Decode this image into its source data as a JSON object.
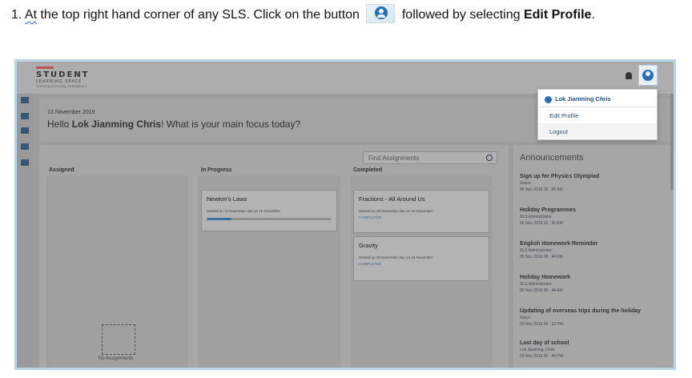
{
  "instruction": {
    "number": "1.",
    "at_text": "At",
    "text_before_icon": "the top right hand corner of any SLS. Click on the button",
    "text_after_icon": "followed by selecting",
    "bold_target": "Edit Profile",
    "end_punct": "."
  },
  "app": {
    "logo_line1": "STUDENT",
    "logo_line2": "LEARNING SPACE",
    "logo_line3": "Learning everyday, everywhere"
  },
  "greeting": {
    "date": "13 November 2019",
    "hello_prefix": "Hello",
    "user_name": "Lok Jianming Chris",
    "hello_suffix": "! What is your main focus today?"
  },
  "user_menu": {
    "user_name": "Lok Jianming Chris",
    "edit_profile": "Edit Profile",
    "logout": "Logout"
  },
  "board": {
    "search_placeholder": "Find Assignments",
    "columns": {
      "assigned": "Assigned",
      "in_progress": "In Progress",
      "completed": "Completed"
    },
    "empty_text": "No Assignments",
    "in_progress_cards": [
      {
        "title": "Newton's Laws",
        "sub": "Started on 10 November due on 11 November",
        "progress_percent": 20
      }
    ],
    "completed_cards": [
      {
        "title": "Fractions - All Around Us",
        "sub": "Started on 28 November due on 18 November",
        "status": "COMPLETED"
      },
      {
        "title": "Gravity",
        "sub": "Started on 05 November due on 18 November",
        "status": "COMPLETED"
      }
    ]
  },
  "announcements": {
    "title": "Announcements",
    "items": [
      {
        "title": "Sign up for Physics Olympiad",
        "author": "Grace",
        "date": "05 Nov 2019 10 : 56 AM"
      },
      {
        "title": "Holiday Programmes",
        "author": "SLS Administrator",
        "date": "05 Nov 2019 10 : 30 AM"
      },
      {
        "title": "English Homework Reminder",
        "author": "SLS Administrator",
        "date": "05 Nov 2019 09 : 44 AM"
      },
      {
        "title": "Holiday Homework",
        "author": "SLS Administrator",
        "date": "05 Nov 2019 09 : 44 AM"
      },
      {
        "title": "Updating of overseas trips during the holiday",
        "author": "Grace",
        "date": "03 Nov 2019 06 : 12 PM"
      },
      {
        "title": "Last day of school",
        "author": "Lok Jianming, Chris",
        "date": "03 Nov 2019 05 : 49 PM"
      }
    ]
  },
  "icons": [
    "bell-icon",
    "user-avatar-icon",
    "search-icon",
    "menu-icon",
    "home-icon"
  ]
}
